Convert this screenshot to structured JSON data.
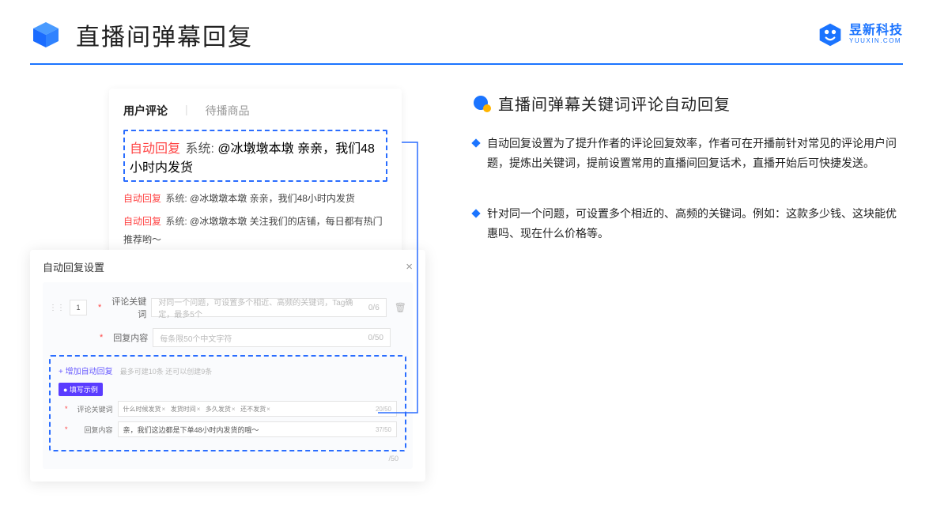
{
  "brand": {
    "cn": "昱新科技",
    "en": "YUUXIN.COM"
  },
  "page_title": "直播间弹幕回复",
  "tabs": {
    "active": "用户评论",
    "inactive": "待播商品"
  },
  "comments": {
    "first": {
      "tag": "自动回复",
      "sys": "系统:",
      "body": "@冰墩墩本墩 亲亲，我们48小时内发货"
    },
    "second": {
      "tag": "自动回复",
      "sys": "系统:",
      "body": "@冰墩墩本墩 亲亲，我们48小时内发货"
    },
    "third": {
      "tag": "自动回复",
      "sys": "系统:",
      "body": "@冰墩墩本墩 关注我们的店铺，每日都有热门推荐哟～"
    }
  },
  "settings": {
    "title": "自动回复设置",
    "num": "1",
    "kw_label": "评论关键词",
    "kw_placeholder": "对同一个问题，可设置多个相近、高频的关键词，Tag确定，最多5个",
    "kw_count": "0/6",
    "reply_label": "回复内容",
    "reply_placeholder": "每条限50个中文字符",
    "reply_count": "0/50",
    "add_link": "+ 增加自动回复",
    "add_hint": "最多可建10条 还可以创建9条",
    "example_badge": "● 填写示例",
    "ex_kw_label": "评论关键词",
    "ex_chips": {
      "a": "什么时候发货",
      "b": "发货时间",
      "c": "多久发货",
      "d": "还不发货"
    },
    "ex_kw_count": "20/50",
    "ex_reply_label": "回复内容",
    "ex_reply_value": "亲，我们这边都是下单48小时内发货的哦～",
    "ex_reply_count": "37/50",
    "tail_count": "/50"
  },
  "right": {
    "section_title": "直播间弹幕关键词评论自动回复",
    "bullet1": "自动回复设置为了提升作者的评论回复效率，作者可在开播前针对常见的评论用户问题，提炼出关键词，提前设置常用的直播间回复话术，直播开始后可快捷发送。",
    "bullet2": "针对同一个问题，可设置多个相近的、高频的关键词。例如：这款多少钱、这块能优惠吗、现在什么价格等。"
  }
}
